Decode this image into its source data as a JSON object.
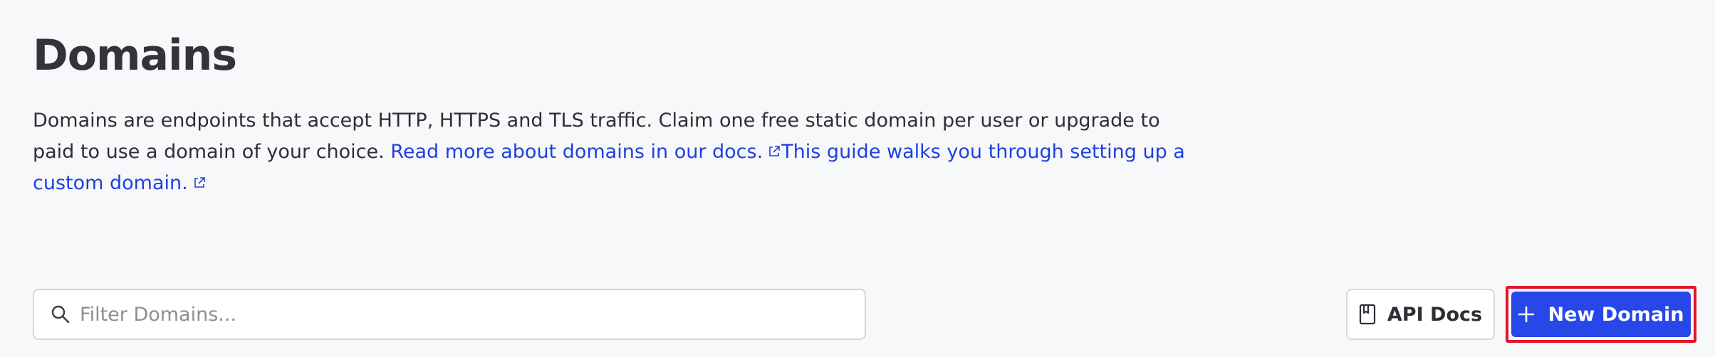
{
  "page": {
    "title": "Domains",
    "description_text": "Domains are endpoints that accept HTTP, HTTPS and TLS traffic. Claim one free static domain per user or upgrade to paid to use a domain of your choice. ",
    "docs_link": "Read more about domains in our docs.",
    "guide_link": "This guide walks you through setting up a custom domain."
  },
  "filter": {
    "placeholder": "Filter Domains...",
    "value": ""
  },
  "buttons": {
    "api_docs": "API Docs",
    "new_domain": "New Domain"
  },
  "icons": {
    "search": "search-icon",
    "external_link": "external-link-icon",
    "book": "book-icon",
    "plus": "plus-icon"
  },
  "colors": {
    "link": "#1f40e0",
    "primary_button": "#2747e8",
    "highlight_border": "#e0142a",
    "background": "#f7f8fa"
  }
}
